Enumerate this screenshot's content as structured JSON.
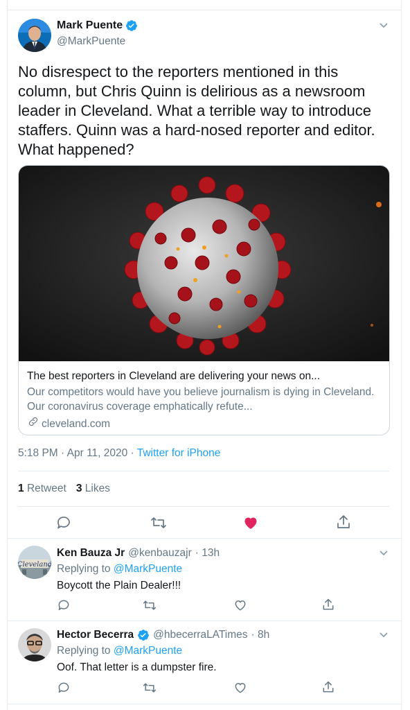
{
  "main_tweet": {
    "display_name": "Mark Puente",
    "handle": "@MarkPuente",
    "text": "No disrespect to the reporters mentioned in this column, but Chris Quinn is delirious as a newsroom leader in Cleveland. What a terrible way to introduce staffers. Quinn was a hard-nosed reporter and editor. What happened?",
    "card": {
      "title": "The best reporters in Cleveland are delivering your news on...",
      "description": "Our competitors would have you believe journalism is dying in Cleveland. Our coronavirus coverage emphatically refute...",
      "domain": "cleveland.com"
    },
    "timestamp": "5:18 PM · Apr 11, 2020 · ",
    "source": "Twitter for iPhone",
    "retweet_count": "1",
    "retweet_label": "Retweet",
    "like_count": "3",
    "like_label": "Likes",
    "liked": true
  },
  "replies": [
    {
      "display_name": "Ken Bauza Jr",
      "handle": "@kenbauzajr",
      "meta": "· 13h",
      "replying_label": "Replying to",
      "replying_to": "@MarkPuente",
      "text": "Boycott the Plain Dealer!!!",
      "verified": false
    },
    {
      "display_name": "Hector Becerra",
      "handle": "@hbecerraLATimes",
      "meta": "· 8h",
      "replying_label": "Replying to",
      "replying_to": "@MarkPuente",
      "text": "Oof. That letter is a dumpster fire.",
      "verified": true
    }
  ],
  "colors": {
    "accent": "#1da1f2",
    "like": "#e0245e",
    "muted": "#657786",
    "text": "#14171a",
    "border": "#e6ecf0"
  },
  "icons": [
    "verified-badge-icon",
    "chevron-down-icon",
    "reply-icon",
    "retweet-icon",
    "like-icon",
    "share-icon",
    "link-icon"
  ]
}
